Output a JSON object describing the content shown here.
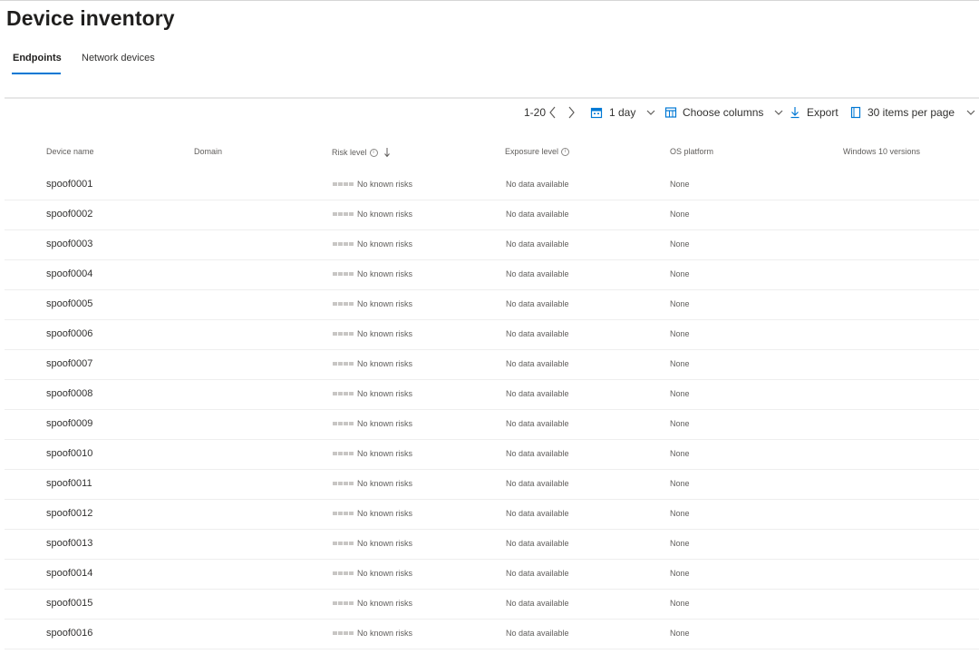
{
  "page": {
    "title": "Device inventory"
  },
  "tabs": [
    {
      "label": "Endpoints",
      "active": true
    },
    {
      "label": "Network devices",
      "active": false
    }
  ],
  "toolbar": {
    "range": "1-20",
    "time_filter": "1 day",
    "choose_columns": "Choose columns",
    "export": "Export",
    "items_per_page": "30 items per page"
  },
  "columns": {
    "device_name": "Device name",
    "domain": "Domain",
    "risk_level": "Risk level",
    "exposure_level": "Exposure level",
    "os_platform": "OS platform",
    "windows_versions": "Windows 10 versions"
  },
  "rows": [
    {
      "name": "spoof0001",
      "risk": "No known risks",
      "exposure": "No data available",
      "os": "None"
    },
    {
      "name": "spoof0002",
      "risk": "No known risks",
      "exposure": "No data available",
      "os": "None"
    },
    {
      "name": "spoof0003",
      "risk": "No known risks",
      "exposure": "No data available",
      "os": "None"
    },
    {
      "name": "spoof0004",
      "risk": "No known risks",
      "exposure": "No data available",
      "os": "None"
    },
    {
      "name": "spoof0005",
      "risk": "No known risks",
      "exposure": "No data available",
      "os": "None"
    },
    {
      "name": "spoof0006",
      "risk": "No known risks",
      "exposure": "No data available",
      "os": "None"
    },
    {
      "name": "spoof0007",
      "risk": "No known risks",
      "exposure": "No data available",
      "os": "None"
    },
    {
      "name": "spoof0008",
      "risk": "No known risks",
      "exposure": "No data available",
      "os": "None"
    },
    {
      "name": "spoof0009",
      "risk": "No known risks",
      "exposure": "No data available",
      "os": "None"
    },
    {
      "name": "spoof0010",
      "risk": "No known risks",
      "exposure": "No data available",
      "os": "None"
    },
    {
      "name": "spoof0011",
      "risk": "No known risks",
      "exposure": "No data available",
      "os": "None"
    },
    {
      "name": "spoof0012",
      "risk": "No known risks",
      "exposure": "No data available",
      "os": "None"
    },
    {
      "name": "spoof0013",
      "risk": "No known risks",
      "exposure": "No data available",
      "os": "None"
    },
    {
      "name": "spoof0014",
      "risk": "No known risks",
      "exposure": "No data available",
      "os": "None"
    },
    {
      "name": "spoof0015",
      "risk": "No known risks",
      "exposure": "No data available",
      "os": "None"
    },
    {
      "name": "spoof0016",
      "risk": "No known risks",
      "exposure": "No data available",
      "os": "None"
    }
  ],
  "icons": {
    "prev": "chevron-left-icon",
    "next": "chevron-right-icon",
    "calendar": "calendar-icon",
    "columns": "columns-icon",
    "export": "download-icon",
    "items": "page-icon",
    "sort": "arrow-down-icon",
    "info": "info-icon"
  },
  "colors": {
    "accent": "#0078d4",
    "risk_bar": "#c8c6c4"
  }
}
